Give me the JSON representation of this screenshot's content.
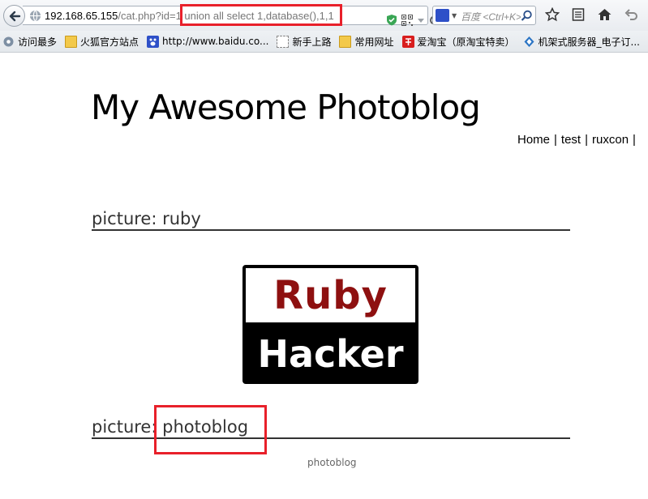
{
  "browser": {
    "url_host": "192.168.65.155",
    "url_path": "/cat.php?id=1",
    "url_injection": " union all select 1,database(),1,1",
    "search_placeholder": "百度 <Ctrl+K>"
  },
  "bookmarks": [
    {
      "label": "访问最多",
      "icon": "gear-icon"
    },
    {
      "label": "火狐官方站点",
      "icon": "folder-icon"
    },
    {
      "label": "http://www.baidu.co...",
      "icon": "baidu-icon"
    },
    {
      "label": "新手上路",
      "icon": "page-icon"
    },
    {
      "label": "常用网址",
      "icon": "folder-icon"
    },
    {
      "label": "爱淘宝（原淘宝特卖）",
      "icon": "taobao-icon"
    },
    {
      "label": "机架式服务器_电子订...",
      "icon": "diamond-icon"
    }
  ],
  "page": {
    "site_title": "My Awesome Photoblog",
    "menu": {
      "home": "Home",
      "test": "test",
      "ruxcon": "ruxcon",
      "separator": "|"
    },
    "picture_1": {
      "title": "picture: ruby"
    },
    "logo": {
      "top_text": "Ruby",
      "bottom_text": "Hacker"
    },
    "picture_2": {
      "title_prefix": "picture: ",
      "title_value": "photoblog"
    },
    "caption": "photoblog"
  },
  "colors": {
    "highlight": "#e8202a",
    "logo_red": "#8e1010"
  }
}
